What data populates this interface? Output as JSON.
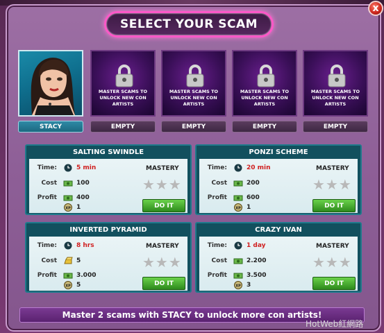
{
  "title": "SELECT YOUR SCAM",
  "close_label": "x",
  "artists": [
    {
      "name": "STACY",
      "locked": false
    },
    {
      "name": "EMPTY",
      "locked": true,
      "message": "MASTER SCAMS TO UNLOCK NEW CON ARTISTS"
    },
    {
      "name": "EMPTY",
      "locked": true,
      "message": "MASTER SCAMS TO UNLOCK NEW CON ARTISTS"
    },
    {
      "name": "EMPTY",
      "locked": true,
      "message": "MASTER SCAMS TO UNLOCK NEW CON ARTISTS"
    },
    {
      "name": "EMPTY",
      "locked": true,
      "message": "MASTER SCAMS TO UNLOCK NEW CON ARTISTS"
    }
  ],
  "labels": {
    "time": "Time:",
    "cost": "Cost",
    "profit": "Profit",
    "xp": "XP",
    "mastery": "MASTERY",
    "do_it": "DO IT"
  },
  "scams": [
    {
      "name": "SALTING SWINDLE",
      "time": "5 min",
      "cost": "100",
      "profit": "400",
      "xp": "1",
      "cost_icon": "cash-icon",
      "mastery_stars": 0
    },
    {
      "name": "PONZI SCHEME",
      "time": "20 min",
      "cost": "200",
      "profit": "600",
      "xp": "1",
      "cost_icon": "cash-icon",
      "mastery_stars": 0
    },
    {
      "name": "INVERTED PYRAMID",
      "time": "8 hrs",
      "cost": "5",
      "profit": "3.000",
      "xp": "5",
      "cost_icon": "gold-bar-icon",
      "mastery_stars": 0
    },
    {
      "name": "CRAZY IVAN",
      "time": "1 day",
      "cost": "2.200",
      "profit": "3.500",
      "xp": "3",
      "cost_icon": "cash-icon",
      "mastery_stars": 0
    }
  ],
  "footer": "Master 2 scams with STACY to unlock more con artists!",
  "watermark": "HotWeb紅網路",
  "colors": {
    "title_glow": "#ff58c8",
    "panel": "#8e5f97",
    "card_header": "#12505e",
    "button": "#3aa02a",
    "time_text": "#d02020"
  }
}
